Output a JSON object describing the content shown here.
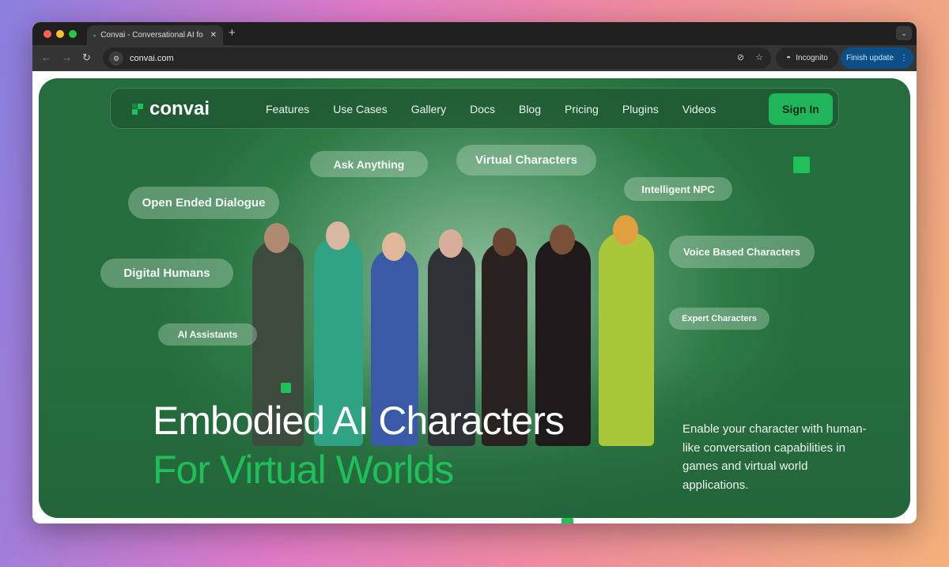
{
  "browser": {
    "tab_title": "Convai - Conversational AI fo",
    "url": "convai.com",
    "incognito_label": "Incognito",
    "update_label": "Finish update",
    "icons": [
      "back-icon",
      "forward-icon",
      "reload-icon",
      "site-settings-icon",
      "eye-off-icon",
      "star-icon",
      "incognito-icon",
      "more-icon",
      "close-icon",
      "plus-icon",
      "chevron-down-icon"
    ]
  },
  "site": {
    "logo_text": "convai",
    "nav": [
      "Features",
      "Use Cases",
      "Gallery",
      "Docs",
      "Blog",
      "Pricing",
      "Plugins",
      "Videos"
    ],
    "signin_label": "Sign In",
    "tags": {
      "ask": "Ask Anything",
      "virtual": "Virtual Characters",
      "npc": "Intelligent NPC",
      "dialogue": "Open Ended Dialogue",
      "voice": "Voice Based Characters",
      "digital": "Digital Humans",
      "expert": "Expert Characters",
      "assistants": "AI Assistants"
    },
    "headline_line1": "Embodied AI Characters",
    "headline_line2": "For Virtual Worlds",
    "description": "Enable your character with human-like conversation capabilities in games and virtual world applications.",
    "colors": {
      "accent": "#1fbf5a",
      "background": "#2d7a45"
    }
  }
}
